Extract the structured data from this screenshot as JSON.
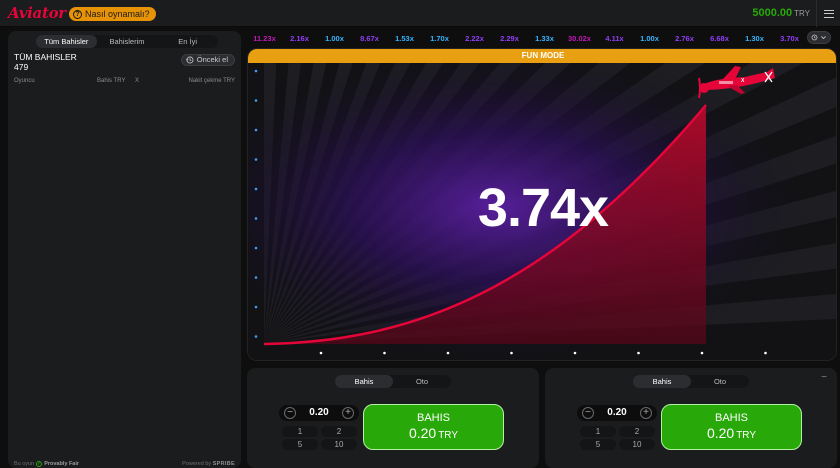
{
  "header": {
    "logo": "Aviator",
    "how_to_play": "Nasıl oynamalı?",
    "balance_amount": "5000.00",
    "balance_currency": "TRY"
  },
  "left_panel": {
    "tabs": [
      {
        "label": "Tüm Bahisler",
        "active": true
      },
      {
        "label": "Bahislerim",
        "active": false
      },
      {
        "label": "En İyi",
        "active": false
      }
    ],
    "title": "TÜM BAHISLER",
    "count": "479",
    "previous_button": "Önceki el",
    "columns": {
      "player": "Oyuncu",
      "bet": "Bahis TRY",
      "x": "X",
      "cashout": "Nakit çekme TRY"
    },
    "footer": {
      "provably_prefix": "Bu oyun",
      "provably_label": "Provably Fair",
      "powered_by": "Powered by",
      "brand": "SPRIBE"
    }
  },
  "history": [
    {
      "value": "11.23x",
      "color": "#c017b4"
    },
    {
      "value": "2.16x",
      "color": "#913ef8"
    },
    {
      "value": "1.00x",
      "color": "#34b4ff"
    },
    {
      "value": "8.67x",
      "color": "#913ef8"
    },
    {
      "value": "1.53x",
      "color": "#34b4ff"
    },
    {
      "value": "1.70x",
      "color": "#34b4ff"
    },
    {
      "value": "2.22x",
      "color": "#913ef8"
    },
    {
      "value": "2.29x",
      "color": "#913ef8"
    },
    {
      "value": "1.33x",
      "color": "#34b4ff"
    },
    {
      "value": "30.02x",
      "color": "#c017b4"
    },
    {
      "value": "4.11x",
      "color": "#913ef8"
    },
    {
      "value": "1.00x",
      "color": "#34b4ff"
    },
    {
      "value": "2.76x",
      "color": "#913ef8"
    },
    {
      "value": "6.68x",
      "color": "#913ef8"
    },
    {
      "value": "1.30x",
      "color": "#34b4ff"
    },
    {
      "value": "3.70x",
      "color": "#913ef8"
    }
  ],
  "game": {
    "mode_banner": "FUN MODE",
    "multiplier": "3.74x"
  },
  "bet_panels": [
    {
      "tabs": [
        {
          "label": "Bahis",
          "active": true
        },
        {
          "label": "Oto",
          "active": false
        }
      ],
      "amount": "0.20",
      "quick_amounts": [
        "1",
        "2",
        "5",
        "10"
      ],
      "button_label": "BAHIS",
      "button_amount": "0.20",
      "button_currency": "TRY"
    },
    {
      "tabs": [
        {
          "label": "Bahis",
          "active": true
        },
        {
          "label": "Oto",
          "active": false
        }
      ],
      "amount": "0.20",
      "quick_amounts": [
        "1",
        "2",
        "5",
        "10"
      ],
      "button_label": "BAHIS",
      "button_amount": "0.20",
      "button_currency": "TRY"
    }
  ],
  "colors": {
    "brand_red": "#e50539",
    "bet_green": "#28a909",
    "fun_mode_orange": "#e8a012",
    "curve_red": "#e50539"
  }
}
